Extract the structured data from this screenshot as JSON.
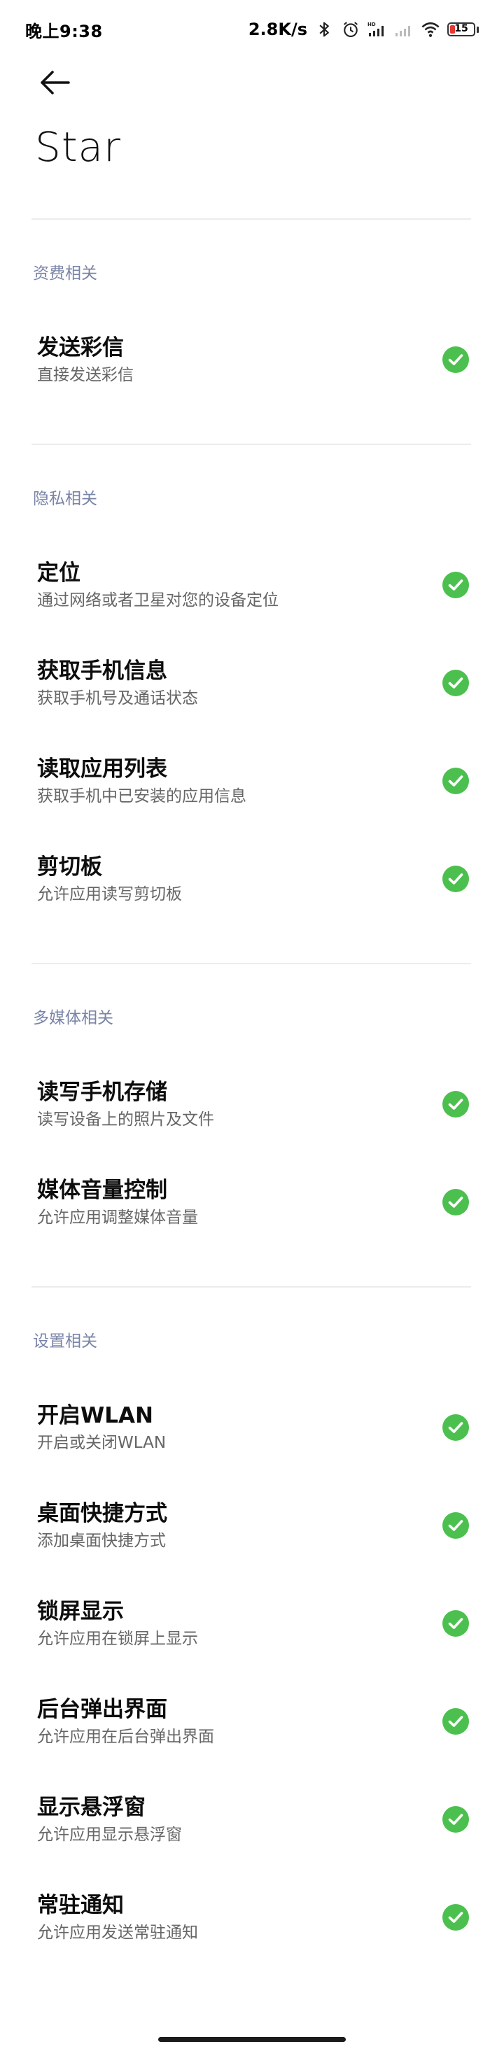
{
  "status_bar": {
    "time": "晚上9:38",
    "net_speed": "2.8K/s",
    "battery_level": "15",
    "icons": [
      "bluetooth-icon",
      "alarm-icon",
      "signal-hd-icon",
      "signal-weak-icon",
      "wifi-icon",
      "battery-icon"
    ]
  },
  "header": {
    "back_icon": "arrow-left-icon",
    "title": "Star"
  },
  "colors": {
    "accent_green": "#4cc04f",
    "section_title": "#7a84a8"
  },
  "sections": [
    {
      "title": "资费相关",
      "items": [
        {
          "title": "发送彩信",
          "desc": "直接发送彩信",
          "checked": true
        }
      ]
    },
    {
      "title": "隐私相关",
      "items": [
        {
          "title": "定位",
          "desc": "通过网络或者卫星对您的设备定位",
          "checked": true
        },
        {
          "title": "获取手机信息",
          "desc": "获取手机号及通话状态",
          "checked": true
        },
        {
          "title": "读取应用列表",
          "desc": "获取手机中已安装的应用信息",
          "checked": true
        },
        {
          "title": "剪切板",
          "desc": "允许应用读写剪切板",
          "checked": true
        }
      ]
    },
    {
      "title": "多媒体相关",
      "items": [
        {
          "title": "读写手机存储",
          "desc": "读写设备上的照片及文件",
          "checked": true
        },
        {
          "title": "媒体音量控制",
          "desc": "允许应用调整媒体音量",
          "checked": true
        }
      ]
    },
    {
      "title": "设置相关",
      "items": [
        {
          "title": "开启WLAN",
          "desc": "开启或关闭WLAN",
          "checked": true
        },
        {
          "title": "桌面快捷方式",
          "desc": "添加桌面快捷方式",
          "checked": true
        },
        {
          "title": "锁屏显示",
          "desc": "允许应用在锁屏上显示",
          "checked": true
        },
        {
          "title": "后台弹出界面",
          "desc": "允许应用在后台弹出界面",
          "checked": true
        },
        {
          "title": "显示悬浮窗",
          "desc": "允许应用显示悬浮窗",
          "checked": true
        },
        {
          "title": "常驻通知",
          "desc": "允许应用发送常驻通知",
          "checked": true
        }
      ]
    }
  ]
}
